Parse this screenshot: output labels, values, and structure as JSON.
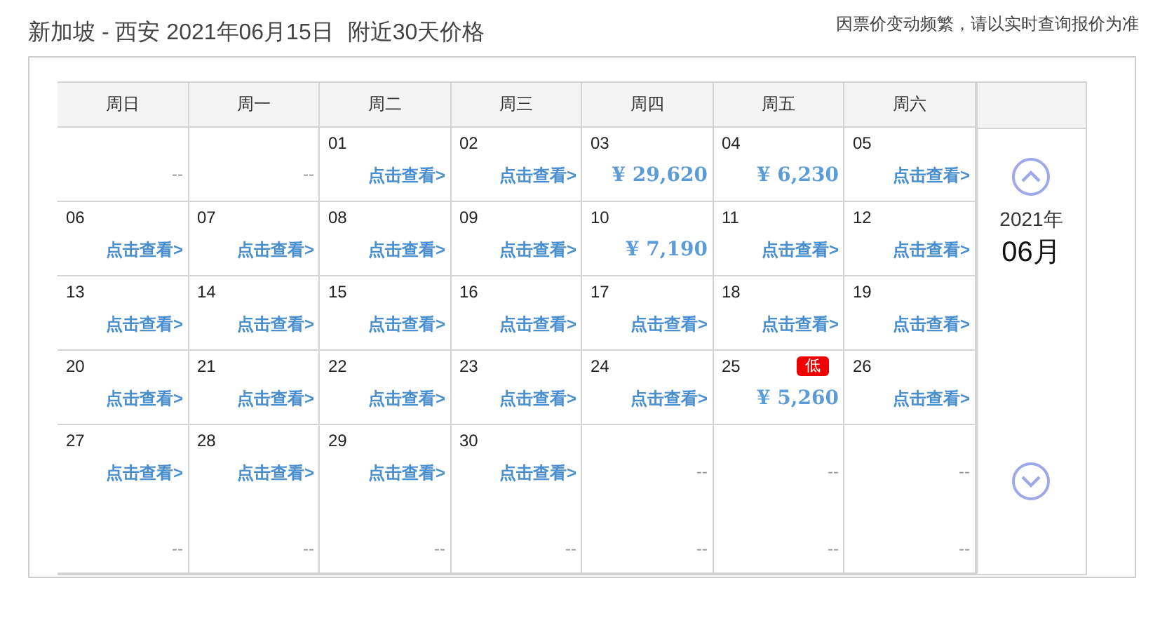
{
  "title": "新加坡 - 西安 2021年06月15日",
  "subtitle": "附近30天价格",
  "note": "因票价变动频繁，请以实时查询报价为准",
  "weekdays": [
    "周日",
    "周一",
    "周二",
    "周三",
    "周四",
    "周五",
    "周六"
  ],
  "weeks": [
    [
      {
        "kind": "dash",
        "text": "--"
      },
      {
        "kind": "dash",
        "text": "--"
      },
      {
        "day": "01",
        "kind": "link",
        "text": "点击查看>"
      },
      {
        "day": "02",
        "kind": "link",
        "text": "点击查看>"
      },
      {
        "day": "03",
        "kind": "price",
        "text": "¥ 29,620"
      },
      {
        "day": "04",
        "kind": "price",
        "text": "¥ 6,230"
      },
      {
        "day": "05",
        "kind": "link",
        "text": "点击查看>"
      }
    ],
    [
      {
        "day": "06",
        "kind": "link",
        "text": "点击查看>"
      },
      {
        "day": "07",
        "kind": "link",
        "text": "点击查看>"
      },
      {
        "day": "08",
        "kind": "link",
        "text": "点击查看>"
      },
      {
        "day": "09",
        "kind": "link",
        "text": "点击查看>"
      },
      {
        "day": "10",
        "kind": "price",
        "text": "¥ 7,190"
      },
      {
        "day": "11",
        "kind": "link",
        "text": "点击查看>"
      },
      {
        "day": "12",
        "kind": "link",
        "text": "点击查看>"
      }
    ],
    [
      {
        "day": "13",
        "kind": "link",
        "text": "点击查看>"
      },
      {
        "day": "14",
        "kind": "link",
        "text": "点击查看>"
      },
      {
        "day": "15",
        "kind": "link",
        "text": "点击查看>"
      },
      {
        "day": "16",
        "kind": "link",
        "text": "点击查看>"
      },
      {
        "day": "17",
        "kind": "link",
        "text": "点击查看>"
      },
      {
        "day": "18",
        "kind": "link",
        "text": "点击查看>"
      },
      {
        "day": "19",
        "kind": "link",
        "text": "点击查看>"
      }
    ],
    [
      {
        "day": "20",
        "kind": "link",
        "text": "点击查看>"
      },
      {
        "day": "21",
        "kind": "link",
        "text": "点击查看>"
      },
      {
        "day": "22",
        "kind": "link",
        "text": "点击查看>"
      },
      {
        "day": "23",
        "kind": "link",
        "text": "点击查看>"
      },
      {
        "day": "24",
        "kind": "link",
        "text": "点击查看>"
      },
      {
        "day": "25",
        "kind": "price",
        "text": "¥ 5,260",
        "badge": "低"
      },
      {
        "day": "26",
        "kind": "link",
        "text": "点击查看>"
      }
    ],
    [
      {
        "day": "27",
        "kind": "link",
        "text": "点击查看>",
        "foot": "--"
      },
      {
        "day": "28",
        "kind": "link",
        "text": "点击查看>",
        "foot": "--"
      },
      {
        "day": "29",
        "kind": "link",
        "text": "点击查看>",
        "foot": "--"
      },
      {
        "day": "30",
        "kind": "link",
        "text": "点击查看>",
        "foot": "--"
      },
      {
        "kind": "dash",
        "text": "--",
        "foot": "--"
      },
      {
        "kind": "dash",
        "text": "--",
        "foot": "--"
      },
      {
        "kind": "dash",
        "text": "--",
        "foot": "--"
      }
    ]
  ],
  "side": {
    "year": "2021年",
    "month": "06月"
  }
}
